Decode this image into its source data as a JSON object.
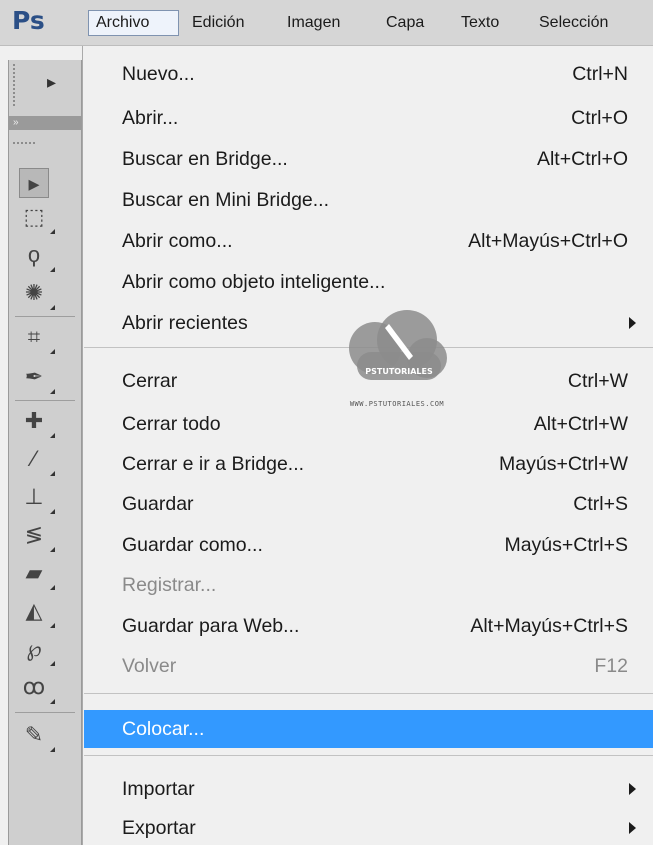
{
  "app": {
    "logo": "Ps"
  },
  "menubar": {
    "items": [
      {
        "label": "Archivo"
      },
      {
        "label": "Edición"
      },
      {
        "label": "Imagen"
      },
      {
        "label": "Capa"
      },
      {
        "label": "Texto"
      },
      {
        "label": "Selección"
      }
    ],
    "active": "Archivo"
  },
  "toolbar": {
    "tools": [
      {
        "icon": "move-tool-icon",
        "glyph": "▸"
      },
      {
        "icon": "marquee-tool-icon",
        "glyph": "⬚"
      },
      {
        "icon": "lasso-tool-icon",
        "glyph": "ϙ"
      },
      {
        "icon": "quick-selection-tool-icon",
        "glyph": "✺"
      },
      {
        "icon": "crop-tool-icon",
        "glyph": "⌗"
      },
      {
        "icon": "eyedropper-tool-icon",
        "glyph": "✒"
      },
      {
        "icon": "healing-brush-tool-icon",
        "glyph": "✚"
      },
      {
        "icon": "brush-tool-icon",
        "glyph": "⁄"
      },
      {
        "icon": "clone-stamp-tool-icon",
        "glyph": "⊥"
      },
      {
        "icon": "history-brush-tool-icon",
        "glyph": "≶"
      },
      {
        "icon": "eraser-tool-icon",
        "glyph": "▰"
      },
      {
        "icon": "paint-bucket-tool-icon",
        "glyph": "◭"
      },
      {
        "icon": "blur-tool-icon",
        "glyph": "℘"
      },
      {
        "icon": "dodge-tool-icon",
        "glyph": "ꝏ"
      },
      {
        "icon": "pen-tool-icon",
        "glyph": "✎"
      }
    ]
  },
  "file_menu": {
    "items": [
      {
        "label": "Nuevo...",
        "shortcut": "Ctrl+N",
        "enabled": true,
        "submenu": false
      },
      {
        "label": "Abrir...",
        "shortcut": "Ctrl+O",
        "enabled": true,
        "submenu": false
      },
      {
        "label": "Buscar en Bridge...",
        "shortcut": "Alt+Ctrl+O",
        "enabled": true,
        "submenu": false
      },
      {
        "label": "Buscar en Mini Bridge...",
        "shortcut": "",
        "enabled": true,
        "submenu": false
      },
      {
        "label": "Abrir como...",
        "shortcut": "Alt+Mayús+Ctrl+O",
        "enabled": true,
        "submenu": false
      },
      {
        "label": "Abrir como objeto inteligente...",
        "shortcut": "",
        "enabled": true,
        "submenu": false
      },
      {
        "label": "Abrir recientes",
        "shortcut": "",
        "enabled": true,
        "submenu": true
      },
      {
        "label": "Cerrar",
        "shortcut": "Ctrl+W",
        "enabled": true,
        "submenu": false
      },
      {
        "label": "Cerrar todo",
        "shortcut": "Alt+Ctrl+W",
        "enabled": true,
        "submenu": false
      },
      {
        "label": "Cerrar e ir a Bridge...",
        "shortcut": "Mayús+Ctrl+W",
        "enabled": true,
        "submenu": false
      },
      {
        "label": "Guardar",
        "shortcut": "Ctrl+S",
        "enabled": true,
        "submenu": false
      },
      {
        "label": "Guardar como...",
        "shortcut": "Mayús+Ctrl+S",
        "enabled": true,
        "submenu": false
      },
      {
        "label": "Registrar...",
        "shortcut": "",
        "enabled": false,
        "submenu": false
      },
      {
        "label": "Guardar para Web...",
        "shortcut": "Alt+Mayús+Ctrl+S",
        "enabled": true,
        "submenu": false
      },
      {
        "label": "Volver",
        "shortcut": "F12",
        "enabled": false,
        "submenu": false
      },
      {
        "label": "Colocar...",
        "shortcut": "",
        "enabled": true,
        "submenu": false,
        "highlighted": true
      },
      {
        "label": "Importar",
        "shortcut": "",
        "enabled": true,
        "submenu": true
      },
      {
        "label": "Exportar",
        "shortcut": "",
        "enabled": true,
        "submenu": true
      }
    ]
  },
  "watermark": {
    "brand": "PSTUTORIALES",
    "url": "WWW.PSTUTORIALES.COM"
  },
  "colors": {
    "highlight": "#3399ff",
    "logo": "#2b4f86",
    "disabled_text": "#8a8a8a"
  }
}
